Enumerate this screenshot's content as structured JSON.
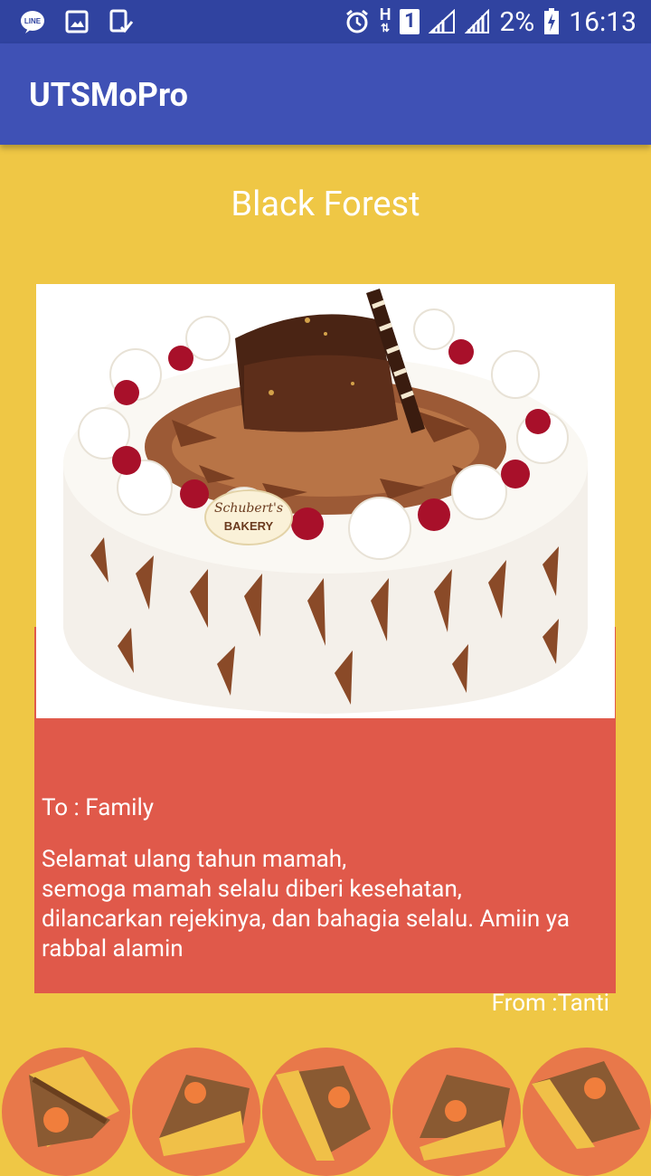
{
  "status_bar": {
    "battery": "2%",
    "time": "16:13",
    "network": "H",
    "sim_slot": "1",
    "icons": [
      "line-app-icon",
      "image-icon",
      "clipboard-check-icon",
      "alarm-icon",
      "network-h-icon",
      "sim-1-icon",
      "signal-icon",
      "signal-icon-2",
      "battery-charging-icon"
    ]
  },
  "app_bar": {
    "title": "UTSMoPro"
  },
  "card": {
    "title": "Black Forest",
    "cake_label": "BAKERY",
    "to": "To : Family",
    "message": "Selamat ulang tahun mamah,\nsemoga mamah selalu diberi kesehatan,\ndilancarkan rejekinya, dan bahagia selalu. Amiin ya rabbal alamin",
    "from": "From :Tanti"
  },
  "colors": {
    "background": "#efc745",
    "app_bar": "#3f51b5",
    "status_bar": "#3043a0",
    "card": "#e0594a",
    "thumb": "#e8784a"
  },
  "thumbnails": [
    {
      "name": "cake-slice-thumb-1"
    },
    {
      "name": "cake-slice-thumb-2"
    },
    {
      "name": "cake-slice-thumb-3"
    },
    {
      "name": "cake-slice-thumb-4"
    },
    {
      "name": "cake-slice-thumb-5"
    }
  ]
}
